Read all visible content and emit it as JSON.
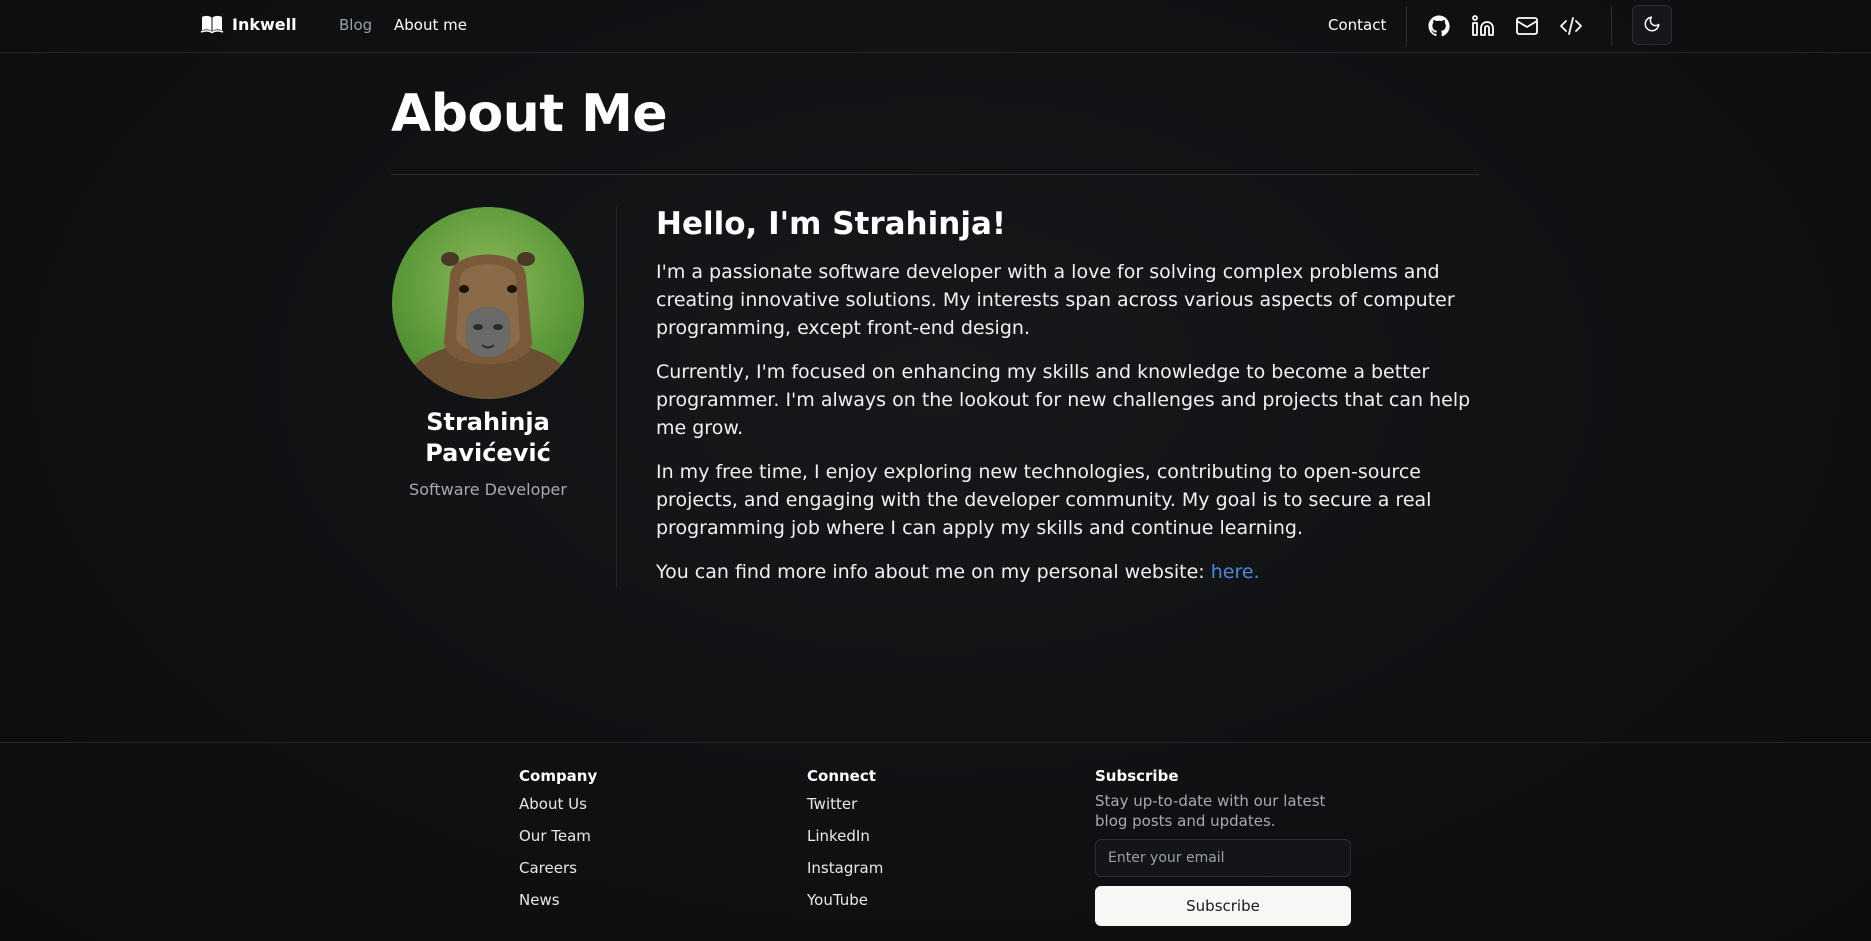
{
  "header": {
    "brand": "Inkwell",
    "nav": {
      "blog": "Blog",
      "about": "About me"
    },
    "contact": "Contact",
    "icons": [
      "book-icon",
      "github-icon",
      "linkedin-icon",
      "mail-icon",
      "code-icon",
      "moon-icon"
    ]
  },
  "main": {
    "title": "About Me",
    "profile": {
      "name": "Strahinja Pavićević",
      "role": "Software Developer"
    },
    "greeting": "Hello, I'm Strahinja!",
    "paragraphs": [
      "I'm a passionate software developer with a love for solving complex problems and creating innovative solutions. My interests span across various aspects of computer programming, except front-end design.",
      "Currently, I'm focused on enhancing my skills and knowledge to become a better programmer. I'm always on the lookout for new challenges and projects that can help me grow.",
      "In my free time, I enjoy exploring new technologies, contributing to open-source projects, and engaging with the developer community. My goal is to secure a real programming job where I can apply my skills and continue learning."
    ],
    "website_text": "You can find more info about me on my personal website: ",
    "website_link": "here."
  },
  "footer": {
    "company": {
      "heading": "Company",
      "links": [
        "About Us",
        "Our Team",
        "Careers",
        "News"
      ]
    },
    "connect": {
      "heading": "Connect",
      "links": [
        "Twitter",
        "LinkedIn",
        "Instagram",
        "YouTube"
      ]
    },
    "subscribe": {
      "heading": "Subscribe",
      "description": "Stay up-to-date with our latest blog posts and updates.",
      "placeholder": "Enter your email",
      "button": "Subscribe"
    }
  },
  "colors": {
    "background": "#0f1012",
    "link": "#4f86e0",
    "muted_text": "#a6aab0"
  }
}
